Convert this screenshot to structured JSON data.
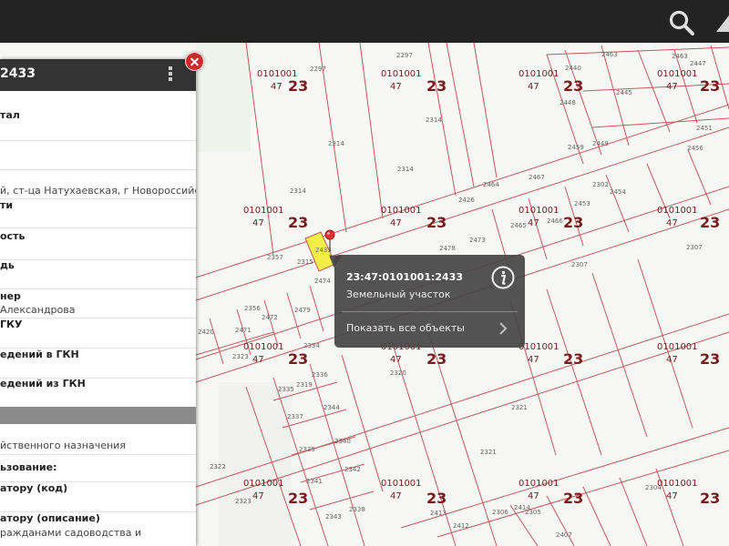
{
  "panel": {
    "title": "2433",
    "rows": [
      {
        "label": "тал",
        "value": ""
      },
      {
        "label": "",
        "value": ""
      },
      {
        "label": "",
        "value": ""
      },
      {
        "label": "",
        "value": "й, ст-ца Натухаевская, г Новороссийск"
      },
      {
        "label": "ти",
        "value": ""
      },
      {
        "label": "ость",
        "value": ""
      },
      {
        "label": "дь",
        "value": ""
      },
      {
        "label": "нер",
        "value": "Александрова"
      },
      {
        "label": "ГКУ",
        "value": ""
      },
      {
        "label": "едений в ГКН",
        "value": ""
      },
      {
        "label": "едений из ГКН",
        "value": ""
      },
      {
        "label": "",
        "value": "йственного назначения"
      },
      {
        "label": "ьзование:",
        "value": ""
      },
      {
        "label": "атору (код)",
        "value": ""
      },
      {
        "label": "атору (описание)",
        "value": "ражданами садоводства и"
      }
    ]
  },
  "popup": {
    "cadastral_number": "23:47:0101001:2433",
    "object_type": "Земельный участок",
    "show_all_link": "Показать все объекты"
  },
  "map": {
    "block_code_a": "0101001",
    "block_code_b": "47",
    "block_code_c": "23",
    "labels": [
      {
        "key": "l1",
        "text": "2297"
      },
      {
        "key": "l2",
        "text": "2297"
      },
      {
        "key": "l3",
        "text": "2463"
      },
      {
        "key": "l4",
        "text": "2463"
      },
      {
        "key": "l5",
        "text": "2440"
      },
      {
        "key": "l6",
        "text": "2447"
      },
      {
        "key": "l7",
        "text": "2445"
      },
      {
        "key": "l8",
        "text": "2448"
      },
      {
        "key": "l9",
        "text": "2314"
      },
      {
        "key": "l10",
        "text": "2314"
      },
      {
        "key": "l11",
        "text": "2314"
      },
      {
        "key": "l12",
        "text": "2314"
      },
      {
        "key": "l13",
        "text": "2449"
      },
      {
        "key": "l14",
        "text": "2451"
      },
      {
        "key": "l15",
        "text": "2456"
      },
      {
        "key": "l16",
        "text": "2467"
      },
      {
        "key": "l17",
        "text": "2464"
      },
      {
        "key": "l18",
        "text": "2426"
      },
      {
        "key": "l19",
        "text": "2459"
      },
      {
        "key": "l20",
        "text": "2302"
      },
      {
        "key": "l21",
        "text": "2454"
      },
      {
        "key": "l22",
        "text": "2453"
      },
      {
        "key": "l23",
        "text": "2466"
      },
      {
        "key": "l24",
        "text": "2465"
      },
      {
        "key": "l25",
        "text": "2473"
      },
      {
        "key": "l26",
        "text": "2478"
      },
      {
        "key": "l27",
        "text": "2315"
      },
      {
        "key": "l28",
        "text": "2357"
      },
      {
        "key": "l29",
        "text": "2307"
      },
      {
        "key": "l30",
        "text": "2307"
      },
      {
        "key": "l31",
        "text": "2474"
      },
      {
        "key": "l32",
        "text": "2479"
      },
      {
        "key": "l33",
        "text": "2472"
      },
      {
        "key": "l34",
        "text": "2471"
      },
      {
        "key": "l35",
        "text": "2420"
      },
      {
        "key": "l36",
        "text": "2356"
      },
      {
        "key": "l37",
        "text": "2334"
      },
      {
        "key": "l38",
        "text": "2319"
      },
      {
        "key": "l39",
        "text": "2335"
      },
      {
        "key": "l40",
        "text": "2336"
      },
      {
        "key": "l41",
        "text": "2344"
      },
      {
        "key": "l42",
        "text": "2337"
      },
      {
        "key": "l43",
        "text": "2340"
      },
      {
        "key": "l44",
        "text": "2339"
      },
      {
        "key": "l45",
        "text": "2342"
      },
      {
        "key": "l46",
        "text": "2341"
      },
      {
        "key": "l47",
        "text": "2338"
      },
      {
        "key": "l48",
        "text": "2320"
      },
      {
        "key": "l49",
        "text": "2321"
      },
      {
        "key": "l50",
        "text": "2321"
      },
      {
        "key": "l51",
        "text": "2323"
      },
      {
        "key": "l52",
        "text": "2323"
      },
      {
        "key": "l53",
        "text": "2322"
      },
      {
        "key": "l54",
        "text": "2306"
      },
      {
        "key": "l55",
        "text": "2305"
      },
      {
        "key": "l56",
        "text": "2304"
      },
      {
        "key": "l57",
        "text": "2412"
      },
      {
        "key": "l58",
        "text": "2413"
      },
      {
        "key": "l59",
        "text": "2414"
      },
      {
        "key": "l60",
        "text": "2407"
      },
      {
        "key": "l61",
        "text": "2343"
      },
      {
        "key": "l62",
        "text": "2433"
      }
    ]
  },
  "colors": {
    "topbar": "#232323",
    "boundary": "#c8585a",
    "highlight": "#f3ef47",
    "close_button": "#cf2a2a"
  },
  "icons": {
    "search": "search-icon",
    "info": "info-icon",
    "chevron": "chevron-right-icon",
    "close": "close-icon",
    "pin": "map-pin-icon"
  }
}
